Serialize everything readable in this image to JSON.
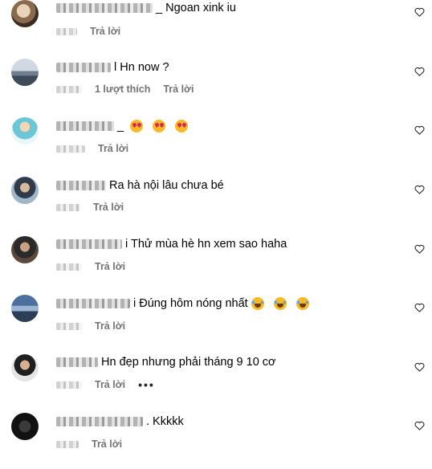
{
  "comments": [
    {
      "text": "_ Ngoan xink iu",
      "reply": "Trả lời",
      "likes": ""
    },
    {
      "text": "l Hn now ?",
      "reply": "Trả lời",
      "likes": "1 lượt thích"
    },
    {
      "text": "_",
      "reply": "Trả lời",
      "likes": "",
      "emojis": "love x3"
    },
    {
      "text": "Ra hà nội lâu chưa bé",
      "reply": "Trả lời",
      "likes": ""
    },
    {
      "text": "i Thử mùa hè hn xem sao haha",
      "reply": "Trả lời",
      "likes": ""
    },
    {
      "text": "i Đúng hôm nóng nhất",
      "reply": "Trả lời",
      "likes": "",
      "emojis": "laugh x3"
    },
    {
      "text": "Hn đẹp nhưng phải tháng 9 10 cơ",
      "reply": "Trả lời",
      "likes": "",
      "more": "•••"
    },
    {
      "text": ". Kkkkk",
      "reply": "Trả lời",
      "likes": ""
    }
  ],
  "colors": {
    "meta": "#737373",
    "text": "#000000",
    "heart": "#262626"
  }
}
